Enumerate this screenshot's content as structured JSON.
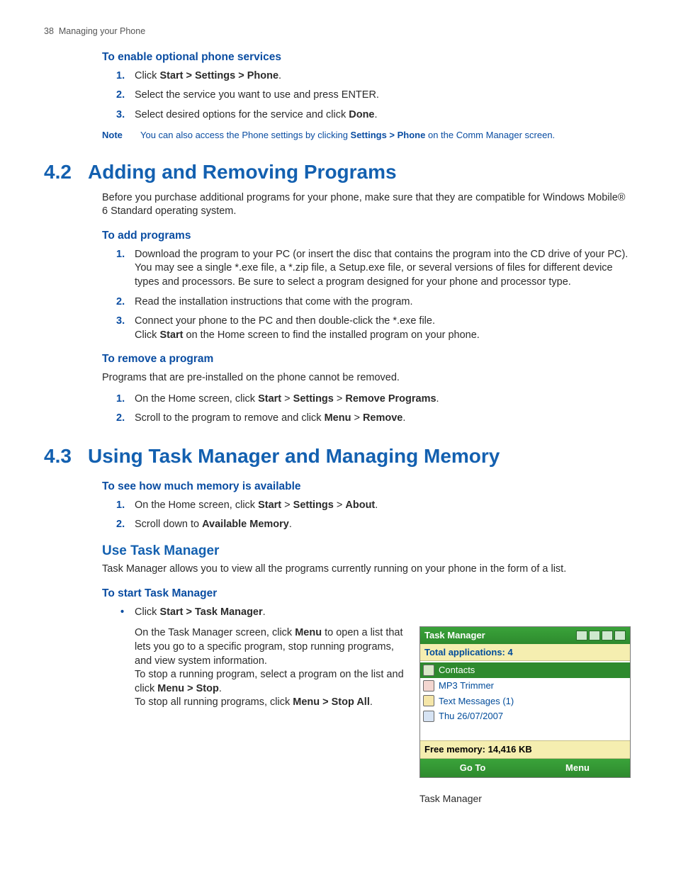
{
  "running_head": {
    "page": "38",
    "title": "Managing your Phone"
  },
  "sec_enable": {
    "title": "To enable optional phone services",
    "items": [
      {
        "pre": "Click ",
        "b1": "Start > Settings > Phone",
        "post": "."
      },
      {
        "pre": "Select the service you want to use and press ENTER.",
        "b1": "",
        "post": ""
      },
      {
        "pre": "Select desired options for the service and click ",
        "b1": "Done",
        "post": "."
      }
    ],
    "note_label": "Note",
    "note_pre": "You can also access the Phone settings by clicking ",
    "note_b": "Settings > Phone",
    "note_post": " on the Comm Manager screen."
  },
  "h42": {
    "num": "4.2",
    "title": "Adding and Removing Programs"
  },
  "h42_intro": "Before you purchase additional programs for your phone, make sure that they are compatible for Windows Mobile® 6 Standard operating system.",
  "sec_add": {
    "title": "To add programs",
    "items": [
      "Download the program to your PC (or insert the disc that contains the program into the CD drive of your PC). You may see a single *.exe file, a *.zip file, a Setup.exe file, or several versions of files for different device types and processors. Be sure to select a program designed for your phone and processor type.",
      "Read the installation instructions that come with the program."
    ],
    "item3_line1_pre": "Connect your phone to the PC and then double-click the *.exe file.",
    "item3_line2_a": "Click ",
    "item3_line2_b": "Start",
    "item3_line2_c": " on the Home screen to find the installed program on your phone."
  },
  "sec_remove": {
    "title": "To remove a program",
    "intro": "Programs that are pre-installed on the phone cannot be removed.",
    "i1_a": "On the Home screen, click ",
    "i1_b": "Start",
    "i1_c": " > ",
    "i1_d": "Settings",
    "i1_e": " > ",
    "i1_f": "Remove Programs",
    "i1_g": ".",
    "i2_a": "Scroll to the program to remove and click ",
    "i2_b": "Menu",
    "i2_c": " > ",
    "i2_d": "Remove",
    "i2_e": "."
  },
  "h43": {
    "num": "4.3",
    "title": "Using Task Manager and Managing Memory"
  },
  "sec_mem": {
    "title": "To see how much memory is available",
    "i1_a": "On the Home screen, click ",
    "i1_b": "Start",
    "i1_c": " > ",
    "i1_d": "Settings",
    "i1_e": " > ",
    "i1_f": "About",
    "i1_g": ".",
    "i2_a": "Scroll down to ",
    "i2_b": "Available Memory",
    "i2_c": "."
  },
  "sec_use_tm": {
    "title": "Use Task Manager",
    "intro": "Task Manager allows you to view all the programs currently running on your phone in the form of a list."
  },
  "sec_start_tm": {
    "title": "To start Task Manager",
    "bullet_a": "Click ",
    "bullet_b": "Start > Task Manager",
    "bullet_c": ".",
    "p1_a": "On the Task Manager screen, click ",
    "p1_b": "Menu",
    "p1_c": " to open a list that lets you go to a specific program, stop running programs, and view system information.",
    "p2_a": "To stop a running program, select a program on the list and click ",
    "p2_b": "Menu > Stop",
    "p2_c": ".",
    "p3_a": "To stop all running programs, click ",
    "p3_b": "Menu > Stop All",
    "p3_c": "."
  },
  "screenshot": {
    "title": "Task Manager",
    "total_apps": "Total applications: 4",
    "apps": [
      "Contacts",
      "MP3 Trimmer",
      "Text Messages (1)",
      "Thu 26/07/2007"
    ],
    "free_mem": "Free memory: 14,416 KB",
    "sk_left": "Go To",
    "sk_right": "Menu",
    "caption": "Task Manager"
  }
}
